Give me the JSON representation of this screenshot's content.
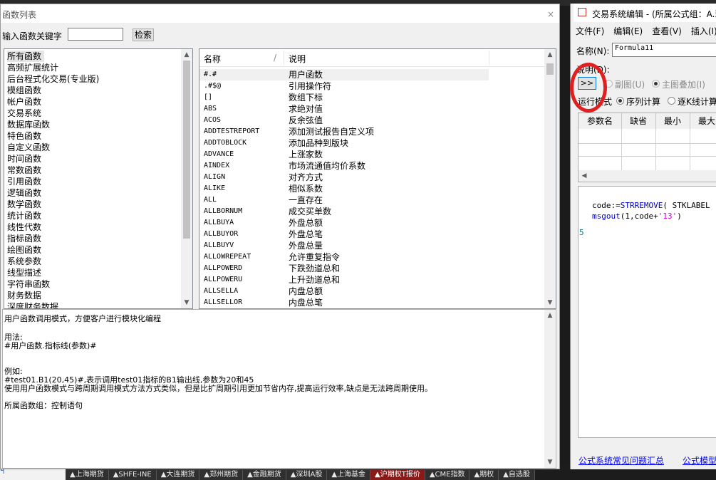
{
  "background": {
    "bottom_tabs": [
      "▲上海期货",
      "▲SHFE-INE",
      "▲大连期货",
      "▲郑州期货",
      "▲金融期货",
      "▲深圳A股",
      "▲上海基金",
      "▲沪期权T报价",
      "▲CME指数",
      "▲期权",
      "▲自选股"
    ],
    "left_stub": "ฯ"
  },
  "function_dialog": {
    "title": "函数列表",
    "close_glyph": "×",
    "search_label": "输入函数关键字",
    "search_value": "",
    "search_button": "检索",
    "categories": [
      "所有函数",
      "高频扩展统计",
      "后台程式化交易(专业版)",
      "模组函数",
      "帐户函数",
      "交易系统",
      "数据库函数",
      "特色函数",
      "自定义函数",
      "时间函数",
      "常数函数",
      "引用函数",
      "逻辑函数",
      "数学函数",
      "统计函数",
      "线性代数",
      "指标函数",
      "绘图函数",
      "系统参数",
      "线型描述",
      "字符串函数",
      "财务数据",
      "深度财务数据"
    ],
    "table_headers": {
      "name": "名称",
      "sort": "/",
      "desc": "说明"
    },
    "functions": [
      {
        "name": "#.#",
        "desc": "用户函数"
      },
      {
        "name": ".#$@",
        "desc": "引用操作符"
      },
      {
        "name": "[]",
        "desc": "数组下标"
      },
      {
        "name": "ABS",
        "desc": "求绝对值"
      },
      {
        "name": "ACOS",
        "desc": "反余弦值"
      },
      {
        "name": "ADDTESTREPORT",
        "desc": "添加测试报告自定义项"
      },
      {
        "name": "ADDTOBLOCK",
        "desc": "添加品种到版块"
      },
      {
        "name": "ADVANCE",
        "desc": "上涨家数"
      },
      {
        "name": "AINDEX",
        "desc": "市场流通值均价系数"
      },
      {
        "name": "ALIGN",
        "desc": "对齐方式"
      },
      {
        "name": "ALIKE",
        "desc": "相似系数"
      },
      {
        "name": "ALL",
        "desc": "一直存在"
      },
      {
        "name": "ALLBORNUM",
        "desc": "成交买单数"
      },
      {
        "name": "ALLBUYA",
        "desc": "外盘总额"
      },
      {
        "name": "ALLBUYOR",
        "desc": "外盘总笔"
      },
      {
        "name": "ALLBUYV",
        "desc": "外盘总量"
      },
      {
        "name": "ALLOWREPEAT",
        "desc": "允许重复指令"
      },
      {
        "name": "ALLPOWERD",
        "desc": "下跌劲道总和"
      },
      {
        "name": "ALLPOWERU",
        "desc": "上升劲道总和"
      },
      {
        "name": "ALLSELLA",
        "desc": "内盘总额"
      },
      {
        "name": "ALLSELLOR",
        "desc": "内盘总笔"
      }
    ],
    "description": {
      "line1": "用户函数调用模式，方便客户进行模块化编程",
      "usage_title": "用法:",
      "usage": "#用户函数.指标线(参数)#",
      "example_title": "例如:",
      "example": "#test01.B1(20,45)#,表示调用test01指标的B1输出线,参数为20和45",
      "note": "使用用户函数模式与跨周期调用模式方法方式类似，但是比扩周期引用更加节省内存,提高运行效率,缺点是无法跨周期使用。",
      "group": "所属函数组：控制语句"
    }
  },
  "editor": {
    "title": "交易系统编辑 - (所属公式组：A.莉",
    "menu": [
      "文件(F)",
      "编辑(E)",
      "查看(V)",
      "插入(I)"
    ],
    "name_label": "名称(N):",
    "name_value": "Formula11",
    "desc_label": "说明(D):",
    "expand_button": ">>",
    "sub_chart_label": "副图(U)",
    "main_overlay_label": "主图叠加(I)",
    "run_mode_label": "运行模式",
    "seq_calc_label": "序列计算",
    "bar_calc_label": "逐K线计算",
    "param_headers": [
      "参数名",
      "缺省",
      "最小",
      "最大"
    ],
    "code": {
      "line1_prefix": "code:=",
      "line1_func": "STRREMOVE",
      "line1_rest": "( STKLABEL",
      "line2_func": "msgout",
      "line2_mid": "(1,code+",
      "line2_str": "'13'",
      "line2_end": ")",
      "line_number": "5"
    },
    "links": [
      "公式系统常见问题汇总",
      "公式模型"
    ]
  },
  "colors": {
    "highlight_circle": "#e02020",
    "link": "#0000ee",
    "active_tab": "#8a1a1a"
  }
}
